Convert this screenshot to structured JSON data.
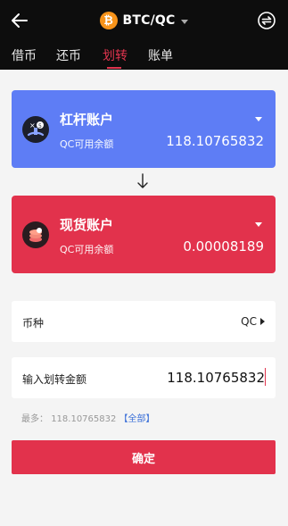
{
  "header": {
    "pair": "BTC/QC",
    "coin_symbol": "₿",
    "coin_color": "#f7931a",
    "back_icon": "arrow-left-icon",
    "swap_icon": "swap-icon"
  },
  "tabs": [
    {
      "label": "借币"
    },
    {
      "label": "还币"
    },
    {
      "label": "划转",
      "active": true
    },
    {
      "label": "账单"
    }
  ],
  "accent_color": "#e2324c",
  "from_account": {
    "title": "杠杆账户",
    "balance_label": "QC可用余额",
    "balance": "118.10765832",
    "color": "#5e7df5"
  },
  "to_account": {
    "title": "现货账户",
    "balance_label": "QC可用余额",
    "balance": "0.00008189",
    "color": "#e2324c"
  },
  "currency": {
    "label": "币种",
    "value": "QC"
  },
  "amount": {
    "label": "输入划转金额",
    "value": "118.10765832"
  },
  "max": {
    "label": "最多：",
    "value": "118.10765832",
    "all_link": "【全部】"
  },
  "confirm_label": "确定"
}
